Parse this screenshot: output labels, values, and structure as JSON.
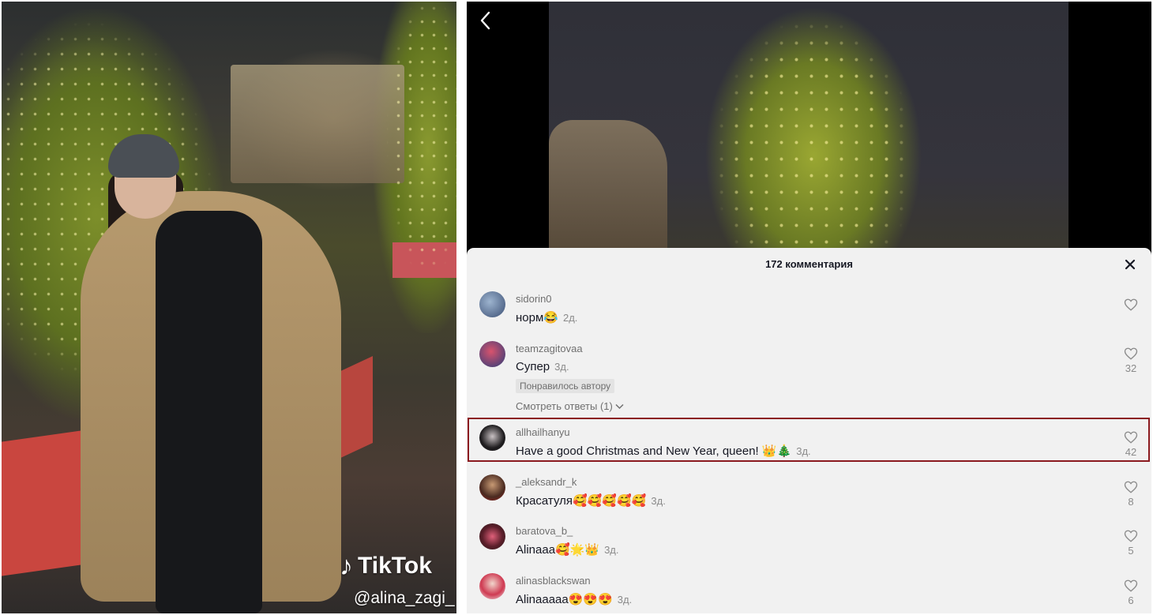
{
  "left_video": {
    "watermark_brand": "TikTok",
    "watermark_user": "@alina_zagi_"
  },
  "comments_panel": {
    "title": "172 комментария",
    "comments": [
      {
        "username": "sidorin0",
        "text": "норм😂",
        "date": "2д.",
        "likes": ""
      },
      {
        "username": "teamzagitovaa",
        "text": "Супер",
        "date": "3д.",
        "likes": "32",
        "badge": "Понравилось автору",
        "view_replies": "Смотреть ответы (1)"
      },
      {
        "username": "allhailhanyu",
        "text": "Have a good Christmas and New Year, queen! 👑🎄",
        "date": "3д.",
        "likes": "42",
        "highlighted": true
      },
      {
        "username": "_aleksandr_k",
        "text": "Красатуля🥰🥰🥰🥰🥰",
        "date": "3д.",
        "likes": "8"
      },
      {
        "username": "baratova_b_",
        "text": "Alinaaa🥰🌟👑",
        "date": "3д.",
        "likes": "5"
      },
      {
        "username": "alinasblackswan",
        "text": "Alinaaaaa😍😍😍",
        "date": "3д.",
        "likes": "6"
      }
    ]
  },
  "colors": {
    "highlight_border": "#8b1a1f",
    "sheet_background": "#f1f1f1"
  },
  "icons": [
    "back-chevron-icon",
    "close-icon",
    "heart-icon",
    "chevron-down-icon",
    "tiktok-logo-icon"
  ]
}
